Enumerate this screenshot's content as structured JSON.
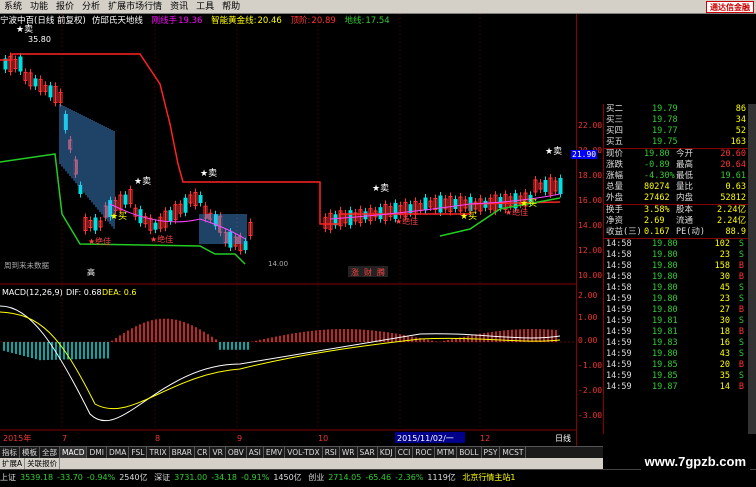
{
  "menu": {
    "items": [
      "系统",
      "功能",
      "报价",
      "分析",
      "扩展市场行情",
      "资讯",
      "工具",
      "帮助"
    ],
    "brand": "通达信金融"
  },
  "title_row": {
    "stock": "宁波中百(日线 前复权)",
    "indicator": "仿邱氏天地线",
    "item1_label": "刚线手",
    "item1_value": "19.36",
    "item2_label": "智能黄金线:",
    "item2_value": "20.46",
    "item3_label": "顶阶:",
    "item3_value": "20.89",
    "item4_label": "地线:",
    "item4_value": "17.54"
  },
  "chart": {
    "top_price": "35.80",
    "news_label": "周到来未数据",
    "bottom_labels": [
      "高",
      "涨",
      "财",
      "腾"
    ],
    "low_label": "14.00",
    "sell_label": "卖",
    "buy_label": "买",
    "bottom_label": "绝佳",
    "macd_label": "MACD(12,26,9)",
    "macd_dif": "DIF: 0.68",
    "macd_dea": "DEA: 0.6",
    "date_axis": [
      "2015年",
      "7",
      "8",
      "9",
      "10",
      "2015/11/02/一",
      "12"
    ],
    "period_label": "日线",
    "price_axis": [
      "22.00",
      "20.00",
      "18.00",
      "16.00",
      "14.00",
      "12.00",
      "10.00"
    ],
    "price_flag": "21.90",
    "macd_axis": [
      "2.00",
      "1.00",
      "0.00",
      "-1.00",
      "-2.00",
      "-3.00"
    ],
    "colors": {
      "up": "#ff3333",
      "down": "#00e0e0",
      "sky": "#ff2222",
      "ground": "#22cc22",
      "ma": "#ffff00"
    }
  },
  "quote": {
    "asks": [
      {
        "label": "买二",
        "price": "19.79",
        "vol": "86"
      },
      {
        "label": "买三",
        "price": "19.78",
        "vol": "34"
      },
      {
        "label": "买四",
        "price": "19.77",
        "vol": "52"
      },
      {
        "label": "买五",
        "price": "19.75",
        "vol": "163"
      }
    ],
    "stats": [
      {
        "l1": "现价",
        "v1": "19.80",
        "l2": "今开",
        "v2": "20.60"
      },
      {
        "l1": "涨跌",
        "v1": "-0.89",
        "l2": "最高",
        "v2": "20.64"
      },
      {
        "l1": "涨幅",
        "v1": "-4.30%",
        "l2": "最低",
        "v2": "19.61"
      },
      {
        "l1": "总量",
        "v1": "80274",
        "l2": "量比",
        "v2": "0.63"
      },
      {
        "l1": "外盘",
        "v1": "27462",
        "l2": "内盘",
        "v2": "52812"
      }
    ],
    "stats2": [
      {
        "l1": "换手",
        "v1": "3.58%",
        "l2": "股本",
        "v2": "2.24亿"
      },
      {
        "l1": "净资",
        "v1": "2.69",
        "l2": "流通",
        "v2": "2.24亿"
      },
      {
        "l1": "收益(三)",
        "v1": "0.167",
        "l2": "PE(动)",
        "v2": "88.9"
      }
    ],
    "ticks": [
      {
        "t": "14:58",
        "p": "19.80",
        "v": "102",
        "s": "S"
      },
      {
        "t": "14:58",
        "p": "19.80",
        "v": "23",
        "s": "S"
      },
      {
        "t": "14:58",
        "p": "19.80",
        "v": "158",
        "s": "B"
      },
      {
        "t": "14:58",
        "p": "19.80",
        "v": "30",
        "s": "B"
      },
      {
        "t": "14:58",
        "p": "19.80",
        "v": "45",
        "s": "S"
      },
      {
        "t": "14:59",
        "p": "19.80",
        "v": "23",
        "s": "S"
      },
      {
        "t": "14:59",
        "p": "19.80",
        "v": "27",
        "s": "B"
      },
      {
        "t": "14:59",
        "p": "19.81",
        "v": "30",
        "s": "S"
      },
      {
        "t": "14:59",
        "p": "19.81",
        "v": "18",
        "s": "B"
      },
      {
        "t": "14:59",
        "p": "19.83",
        "v": "16",
        "s": "S"
      },
      {
        "t": "14:59",
        "p": "19.80",
        "v": "43",
        "s": "S"
      },
      {
        "t": "14:59",
        "p": "19.85",
        "v": "20",
        "s": "B"
      },
      {
        "t": "14:59",
        "p": "19.85",
        "v": "35",
        "s": "S"
      },
      {
        "t": "14:59",
        "p": "19.87",
        "v": "14",
        "s": "B"
      }
    ]
  },
  "tabs": {
    "row1": [
      "指标",
      "模板",
      "全部",
      "MACD",
      "DMI",
      "DMA",
      "FSL",
      "TRIX",
      "BRAR",
      "CR",
      "VR",
      "OBV",
      "ASI",
      "EMV",
      "VOL-TDX",
      "RSI",
      "WR",
      "SAR",
      "KDJ",
      "CCI",
      "ROC",
      "MTM",
      "BOLL",
      "PSY",
      "MCST"
    ],
    "row2": [
      "扩展A",
      "关联报价"
    ]
  },
  "status": {
    "sh_label": "上证",
    "sh_value": "3539.18",
    "sh_change": "-33.70",
    "sh_pct": "-0.94%",
    "sh_amount": "2540亿",
    "sz_label": "深证",
    "sz_value": "3731.00",
    "sz_change": "-34.18",
    "sz_pct": "-0.91%",
    "sz_amount": "1450亿",
    "cy_label": "创业",
    "cy_value": "2714.05",
    "cy_change": "-65.46",
    "cy_pct": "-2.36%",
    "cy_amount": "1119亿",
    "server": "北京行情主站1"
  },
  "watermark": "www.7gpzb.com"
}
